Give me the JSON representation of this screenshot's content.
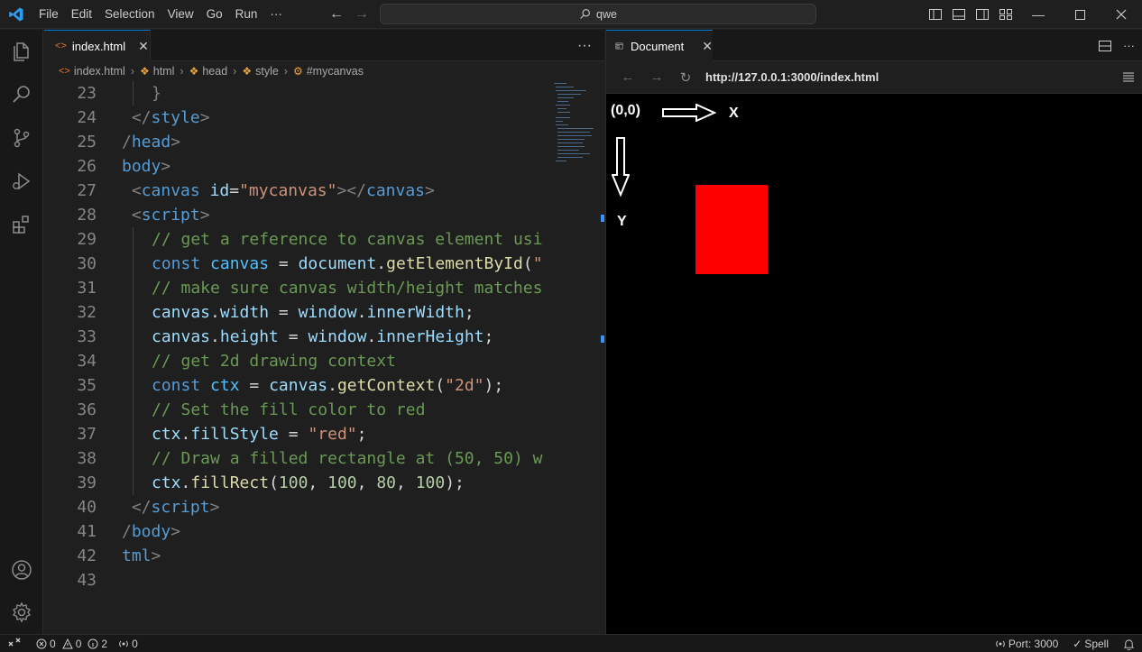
{
  "menu": [
    "File",
    "Edit",
    "Selection",
    "View",
    "Go",
    "Run",
    "···"
  ],
  "command_center": {
    "text": "qwe"
  },
  "editor": {
    "tab": {
      "label": "index.html"
    },
    "breadcrumb": [
      "index.html",
      "html",
      "head",
      "style",
      "#mycanvas"
    ],
    "lines": [
      {
        "n": "23",
        "indent": 1,
        "html": "<span class='pu'>}</span>"
      },
      {
        "n": "24",
        "indent": 0,
        "html": " <span class='pu'>&lt;/</span><span class='tg'>style</span><span class='pu'>&gt;</span>"
      },
      {
        "n": "25",
        "indent": 0,
        "html": "<span class='pu'>/</span><span class='tg'>head</span><span class='pu'>&gt;</span>"
      },
      {
        "n": "26",
        "indent": 0,
        "html": "<span class='tg'>body</span><span class='pu'>&gt;</span>"
      },
      {
        "n": "27",
        "indent": 0,
        "html": " <span class='pu'>&lt;</span><span class='tg'>canvas</span> <span class='at'>id</span><span class='op'>=</span><span class='st'>\"mycanvas\"</span><span class='pu'>&gt;&lt;/</span><span class='tg'>canvas</span><span class='pu'>&gt;</span>"
      },
      {
        "n": "28",
        "indent": 0,
        "html": " <span class='pu'>&lt;</span><span class='tg'>script</span><span class='pu'>&gt;</span>"
      },
      {
        "n": "29",
        "indent": 1,
        "html": "<span class='cm'>// get a reference to canvas element usi</span>"
      },
      {
        "n": "30",
        "indent": 1,
        "html": "<span class='kw'>const</span> <span class='vr'>canvas</span> <span class='op'>=</span> <span class='at'>document</span><span class='op'>.</span><span class='fn'>getElementById</span><span class='op'>(</span><span class='st'>\"</span>"
      },
      {
        "n": "31",
        "indent": 1,
        "html": "<span class='cm'>// make sure canvas width/height matches</span>"
      },
      {
        "n": "32",
        "indent": 1,
        "html": "<span class='at'>canvas</span><span class='op'>.</span><span class='at'>width</span> <span class='op'>=</span> <span class='at'>window</span><span class='op'>.</span><span class='at'>innerWidth</span><span class='op'>;</span>"
      },
      {
        "n": "33",
        "indent": 1,
        "html": "<span class='at'>canvas</span><span class='op'>.</span><span class='at'>height</span> <span class='op'>=</span> <span class='at'>window</span><span class='op'>.</span><span class='at'>innerHeight</span><span class='op'>;</span>"
      },
      {
        "n": "34",
        "indent": 1,
        "html": "<span class='cm'>// get 2d drawing context</span>"
      },
      {
        "n": "35",
        "indent": 1,
        "html": "<span class='kw'>const</span> <span class='vr'>ctx</span> <span class='op'>=</span> <span class='at'>canvas</span><span class='op'>.</span><span class='fn'>getContext</span><span class='op'>(</span><span class='st'>\"2d\"</span><span class='op'>);</span>"
      },
      {
        "n": "36",
        "indent": 1,
        "html": "<span class='cm'>// Set the fill color to red</span>"
      },
      {
        "n": "37",
        "indent": 1,
        "html": "<span class='at'>ctx</span><span class='op'>.</span><span class='at'>fillStyle</span> <span class='op'>=</span> <span class='st'>\"red\"</span><span class='op'>;</span>"
      },
      {
        "n": "38",
        "indent": 1,
        "html": "<span class='cm'>// Draw a filled rectangle at (50, 50) w</span>"
      },
      {
        "n": "39",
        "indent": 1,
        "html": "<span class='at'>ctx</span><span class='op'>.</span><span class='fn'>fillRect</span><span class='op'>(</span><span class='nm'>100</span><span class='op'>, </span><span class='nm'>100</span><span class='op'>, </span><span class='nm'>80</span><span class='op'>, </span><span class='nm'>100</span><span class='op'>);</span>"
      },
      {
        "n": "40",
        "indent": 0,
        "html": " <span class='pu'>&lt;/</span><span class='tg'>script</span><span class='pu'>&gt;</span>"
      },
      {
        "n": "41",
        "indent": 0,
        "html": "<span class='pu'>/</span><span class='tg'>body</span><span class='pu'>&gt;</span>"
      },
      {
        "n": "42",
        "indent": 0,
        "html": "<span class='tg'>tml</span><span class='pu'>&gt;</span>"
      },
      {
        "n": "43",
        "indent": 0,
        "html": ""
      }
    ]
  },
  "preview": {
    "tab": {
      "label": "Document"
    },
    "url": "http://127.0.0.1:3000/index.html",
    "origin_label": "(0,0)",
    "x_label": "X",
    "y_label": "Y",
    "rect_color": "#ff0000"
  },
  "status": {
    "errors": "0",
    "warnings": "0",
    "info": "2",
    "ports": "0",
    "port": "Port: 3000",
    "spell": "Spell"
  },
  "colors": {
    "accent": "#0078d4",
    "background": "#1f1f1f"
  }
}
